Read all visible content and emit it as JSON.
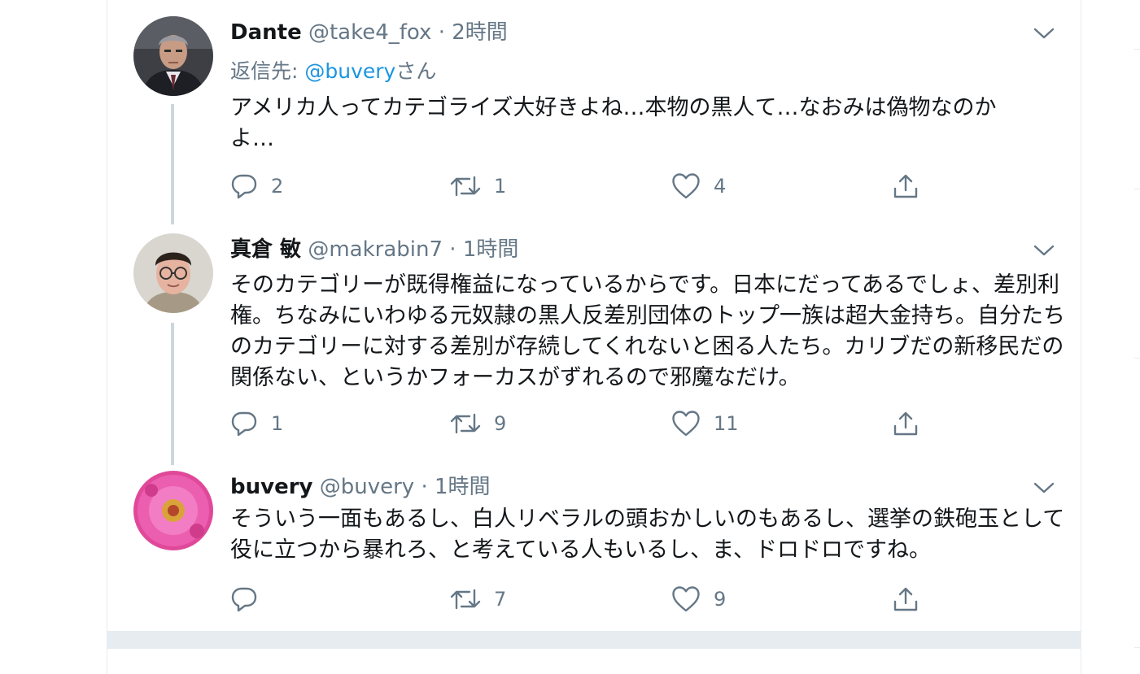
{
  "tweets": [
    {
      "name": "Dante",
      "handle": "@take4_fox",
      "separator": "·",
      "time": "2時間",
      "reply_to_prefix": "返信先: ",
      "reply_to_mention": "@buvery",
      "reply_to_suffix": "さん",
      "text": "アメリカ人ってカテゴライズ大好きよね…本物の黒人て…なおみは偽物なのかよ…",
      "replies": "2",
      "retweets": "1",
      "likes": "4"
    },
    {
      "name": "真倉 敏",
      "handle": "@makrabin7",
      "separator": "·",
      "time": "1時間",
      "text": "そのカテゴリーが既得権益になっているからです。日本にだってあるでしょ、差別利権。ちなみにいわゆる元奴隷の黒人反差別団体のトップ一族は超大金持ち。自分たちのカテゴリーに対する差別が存続してくれないと困る人たち。カリブだの新移民だの関係ない、というかフォーカスがずれるので邪魔なだけ。",
      "replies": "1",
      "retweets": "9",
      "likes": "11"
    },
    {
      "name": "buvery",
      "handle": "@buvery",
      "separator": "·",
      "time": "1時間",
      "text": "そういう一面もあるし、白人リベラルの頭おかしいのもあるし、選挙の鉄砲玉として役に立つから暴れろ、と考えている人もいるし、ま、ドロドロですね。",
      "replies": "",
      "retweets": "7",
      "likes": "9"
    }
  ],
  "icons": {
    "caret": "chevron-down-icon",
    "reply": "reply-icon",
    "retweet": "retweet-icon",
    "like": "heart-icon",
    "share": "share-icon"
  },
  "colors": {
    "text": "#14171a",
    "secondary": "#657786",
    "link": "#1b95e0",
    "thread_line": "#ccd6dd",
    "divider": "#e6ecf0"
  }
}
